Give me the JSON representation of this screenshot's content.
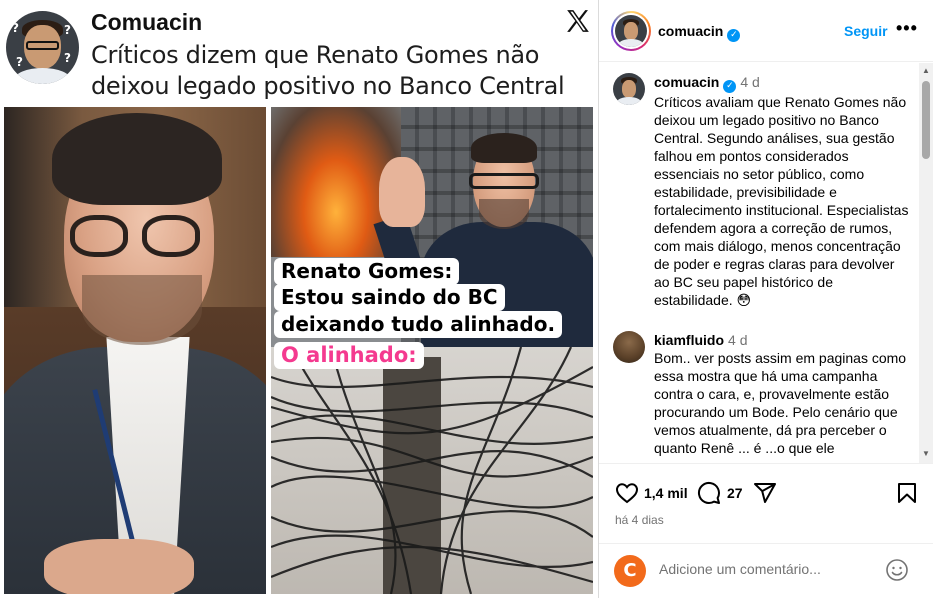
{
  "media": {
    "tweet": {
      "name": "Comuacin",
      "text": "Críticos dizem que Renato Gomes não deixou legado positivo no Banco Central"
    },
    "caption_lines": [
      "Renato Gomes:",
      "Estou saindo do BC",
      "deixando tudo alinhado."
    ],
    "caption_punch": "O alinhado:",
    "icons": {
      "platform_logo": "x-logo-icon"
    }
  },
  "post": {
    "username": "comuacin",
    "follow_label": "Seguir",
    "more_label": "•••",
    "comments": [
      {
        "user": "comuacin",
        "time": "4 d",
        "text": "Críticos avaliam que Renato Gomes não deixou um legado positivo no Banco Central. Segundo análises, sua gestão falhou em pontos considerados essenciais no setor público, como estabilidade, previsibilidade e fortalecimento institucional. Especialistas defendem agora a correção de rumos, com mais diálogo, menos concentração de poder e regras claras para devolver ao BC seu papel histórico de estabilidade. 😳"
      },
      {
        "user": "kiamfluido",
        "time": "4 d",
        "text": "Bom.. ver posts assim em paginas como essa mostra que há uma campanha contra o cara, e, provavelmente estão procurando um Bode. Pelo cenário que vemos atualmente, dá pra perceber o quanto Renê ... é ...o que ele"
      }
    ],
    "likes": "1,4 mil",
    "comment_count": "27",
    "date": "há 4 dias",
    "add_comment_placeholder": "Adicione um comentário...",
    "colors": {
      "accent": "#0095f6",
      "muted": "#737373",
      "punch_pink": "#f43a8f"
    }
  }
}
